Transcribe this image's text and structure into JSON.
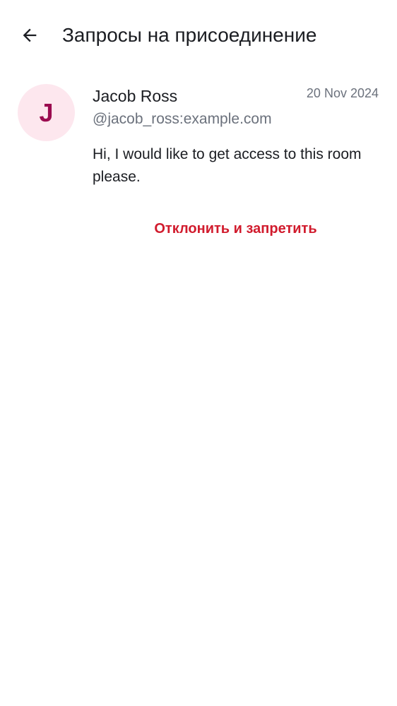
{
  "header": {
    "title": "Запросы на присоединение",
    "back_icon": "arrow-left-icon"
  },
  "request": {
    "avatar_letter": "J",
    "name": "Jacob Ross",
    "user_id": "@jacob_ross:example.com",
    "date": "20 Nov 2024",
    "message": "Hi, I would like to get access to this room please.",
    "decline_ban_label": "Отклонить и запретить"
  },
  "colors": {
    "avatar_bg": "#fde7ee",
    "avatar_text": "#9b0b4f",
    "danger": "#d11b2d",
    "secondary_text": "#6b717c",
    "primary_text": "#1b1d22"
  }
}
